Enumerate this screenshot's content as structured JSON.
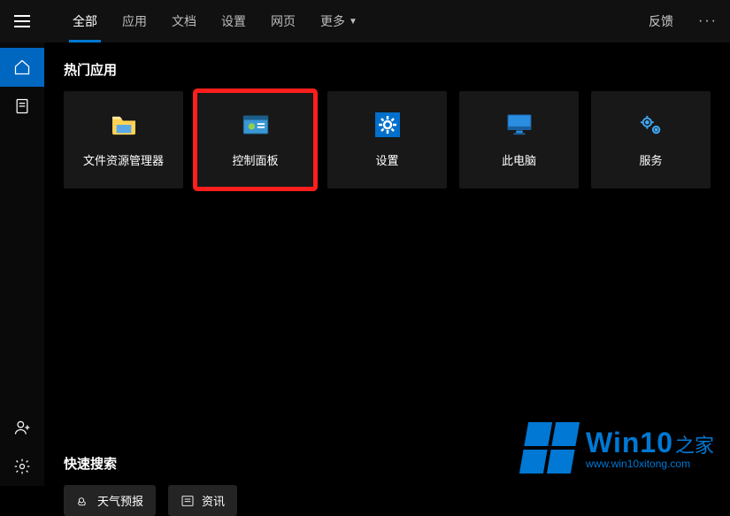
{
  "topbar": {
    "tabs": {
      "all": "全部",
      "apps": "应用",
      "docs": "文档",
      "settings": "设置",
      "web": "网页",
      "more": "更多"
    },
    "feedback": "反馈"
  },
  "sections": {
    "popular_apps": "热门应用",
    "quick_search": "快速搜索"
  },
  "tiles": {
    "explorer": "文件资源管理器",
    "control_panel": "控制面板",
    "settings": "设置",
    "this_pc": "此电脑",
    "services": "服务"
  },
  "quick": {
    "weather": "天气预报",
    "news": "资讯"
  },
  "watermark": {
    "brand_a": "Win10",
    "brand_b": "之家",
    "url": "www.win10xitong.com"
  }
}
